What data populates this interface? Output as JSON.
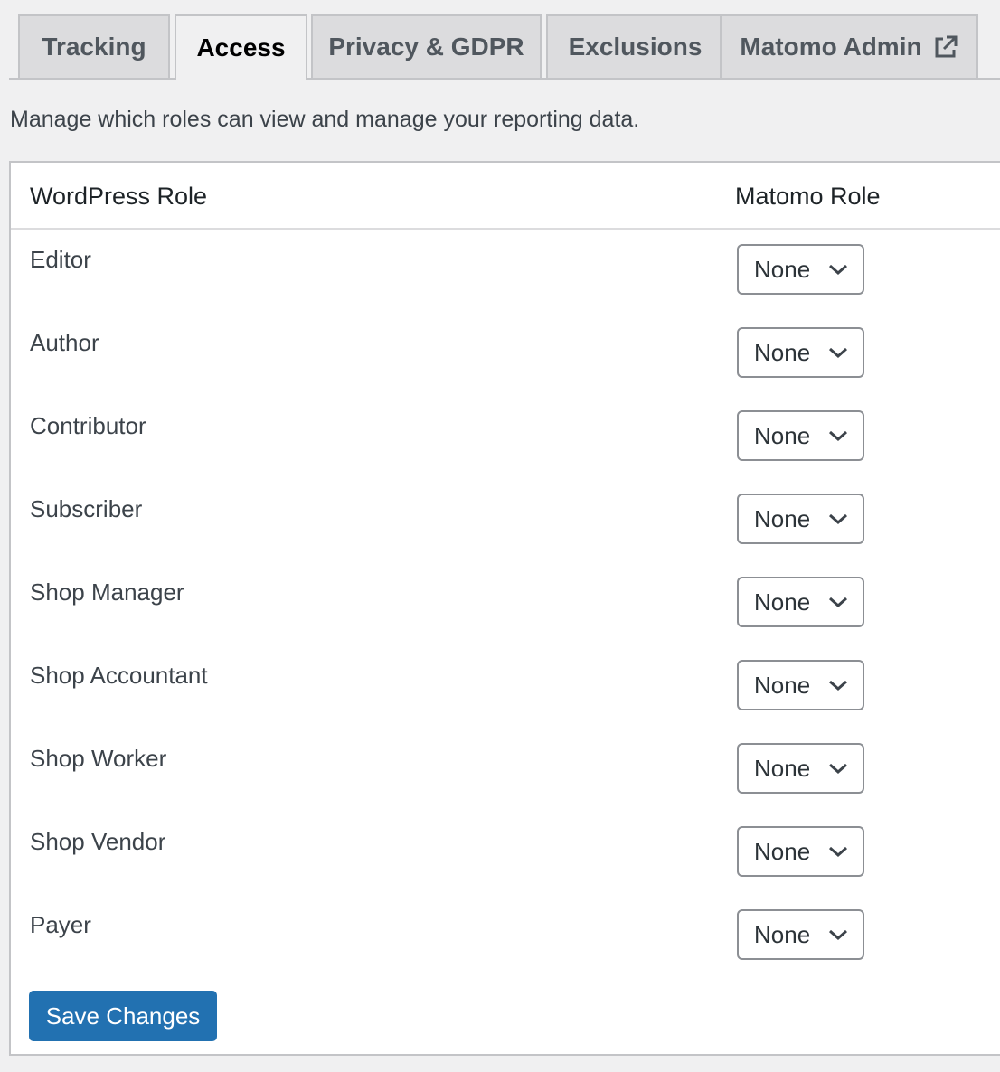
{
  "tabs": [
    {
      "label": "Tracking",
      "active": false
    },
    {
      "label": "Access",
      "active": true
    },
    {
      "label": "Privacy & GDPR",
      "active": false
    },
    {
      "label": "Exclusions",
      "active": false
    },
    {
      "label": "Matomo Admin",
      "active": false,
      "icon": "external-link-icon"
    }
  ],
  "intro_text": "Manage which roles can view and manage your reporting data.",
  "table": {
    "headers": {
      "wordpress_role": "WordPress Role",
      "matomo_role": "Matomo Role"
    },
    "rows": [
      {
        "role": "Editor",
        "matomo_role": "None"
      },
      {
        "role": "Author",
        "matomo_role": "None"
      },
      {
        "role": "Contributor",
        "matomo_role": "None"
      },
      {
        "role": "Subscriber",
        "matomo_role": "None"
      },
      {
        "role": "Shop Manager",
        "matomo_role": "None"
      },
      {
        "role": "Shop Accountant",
        "matomo_role": "None"
      },
      {
        "role": "Shop Worker",
        "matomo_role": "None"
      },
      {
        "role": "Shop Vendor",
        "matomo_role": "None"
      },
      {
        "role": "Payer",
        "matomo_role": "None"
      }
    ]
  },
  "save_button_label": "Save Changes",
  "colors": {
    "page_background": "#f0f0f1",
    "primary_button": "#2271b1",
    "border": "#c3c4c7"
  }
}
